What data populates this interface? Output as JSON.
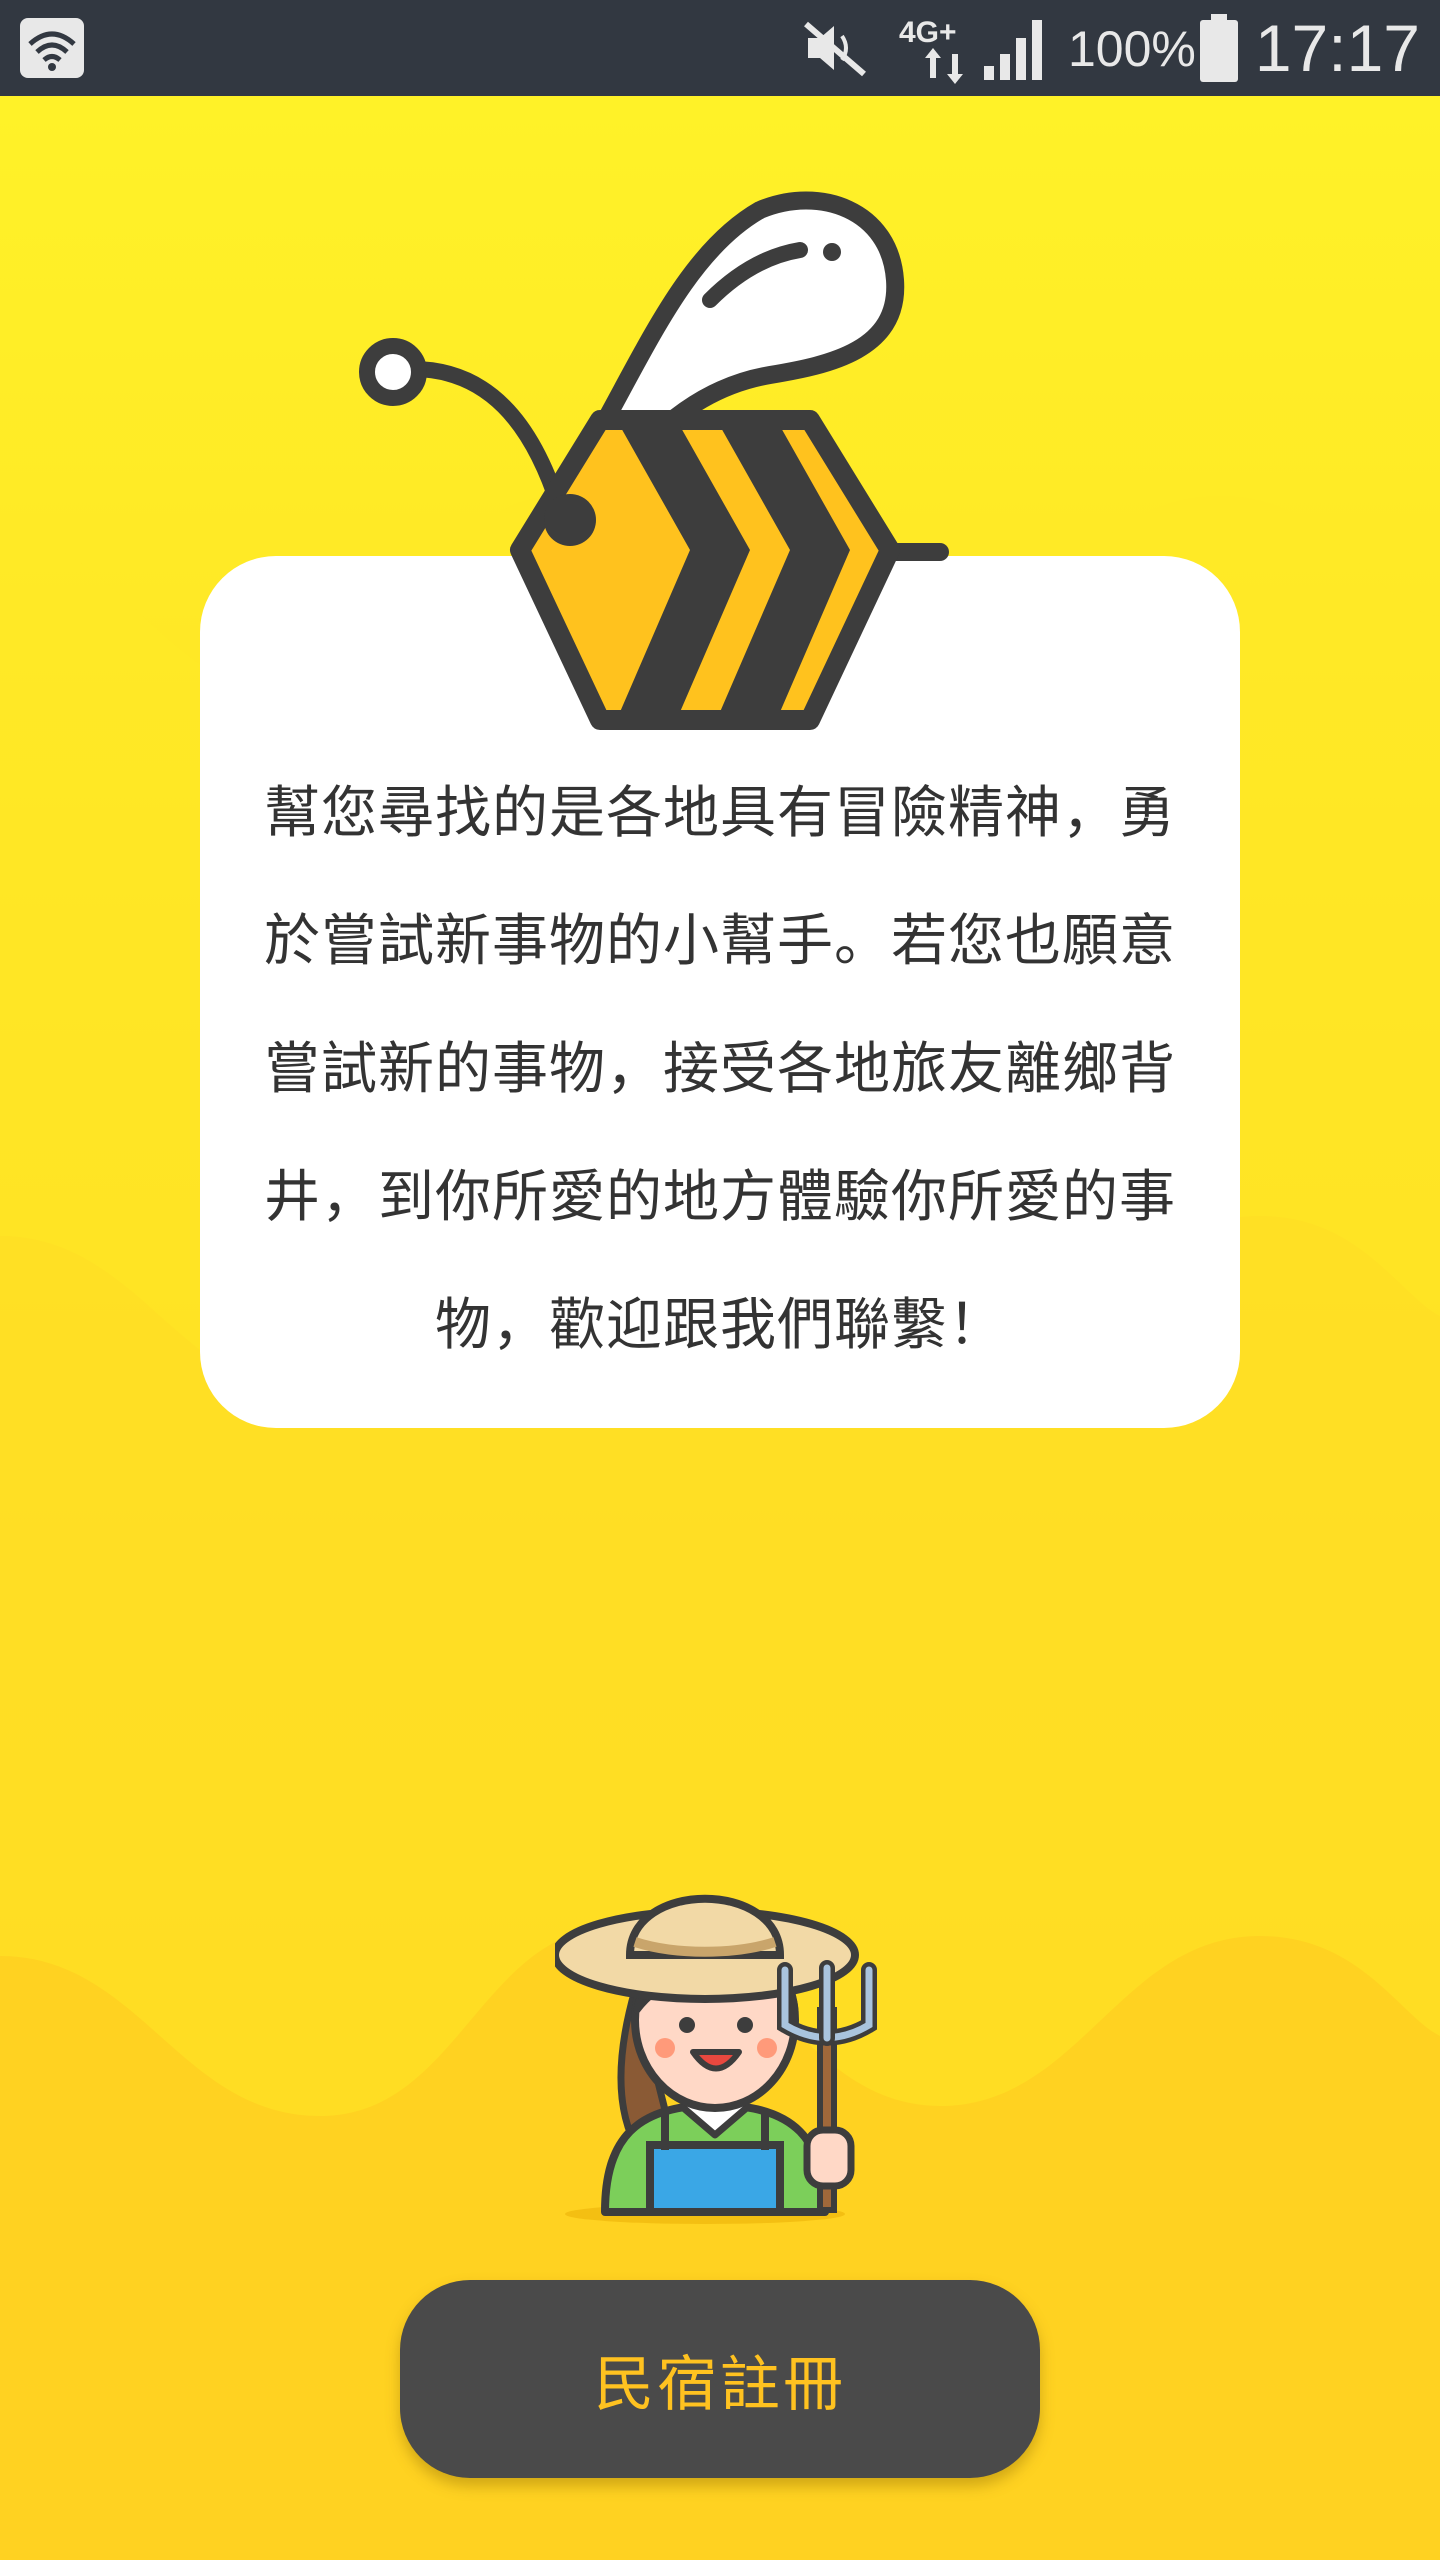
{
  "status_bar": {
    "network": "4G+",
    "battery_percent": "100%",
    "time": "17:17",
    "icons": [
      "wifi-icon",
      "mute-icon",
      "network-4g-icon",
      "signal-icon",
      "battery-icon"
    ]
  },
  "card": {
    "description": "幫您尋找的是各地具有冒險精神，勇於嘗試新事物的小幫手。若您也願意嘗試新的事物，接受各地旅友離鄉背井，到你所愛的地方體驗你所愛的事物，歡迎跟我們聯繫！"
  },
  "illustrations": [
    "bee-logo-icon",
    "farmer-icon"
  ],
  "register_button": {
    "label": "民宿註冊"
  },
  "colors": {
    "status_bar": "#323841",
    "background_top": "#fff228",
    "background_bottom": "#ffc61e",
    "card": "#ffffff",
    "button": "#4a4a4a",
    "button_text": "#ffc220",
    "text": "#333333"
  }
}
